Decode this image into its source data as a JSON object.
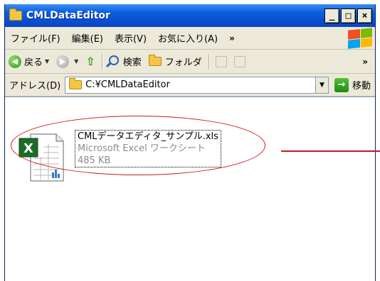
{
  "window": {
    "title": "CMLDataEditor",
    "buttons": {
      "minimize": "_",
      "maximize": "□",
      "close": "×"
    }
  },
  "menubar": {
    "items": [
      "ファイル(F)",
      "編集(E)",
      "表示(V)",
      "お気に入り(A)"
    ],
    "more": "»"
  },
  "toolbar": {
    "back_label": "戻る",
    "search_label": "検索",
    "folders_label": "フォルダ",
    "more": "»"
  },
  "addressbar": {
    "label": "アドレス(D)",
    "path": "C:¥CMLDataEditor",
    "go_label": "移動"
  },
  "file": {
    "name": "CMLデータエディタ_サンプル.xls",
    "type": "Microsoft Excel ワークシート",
    "size": "485 KB"
  },
  "colors": {
    "titlebar": "#0a4fd3",
    "chrome": "#ece9d8",
    "annotation": "#d0141d"
  }
}
